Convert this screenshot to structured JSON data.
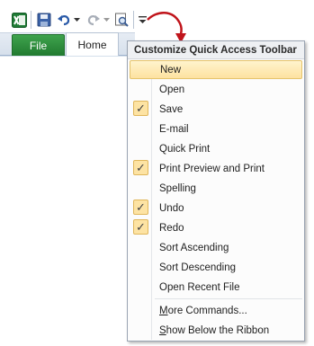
{
  "qat": {
    "icons": [
      "excel-logo-icon",
      "save-icon",
      "undo-icon",
      "dropdown-arrow-icon",
      "redo-icon",
      "dropdown-arrow-icon",
      "print-preview-icon",
      "customize-dropdown-icon"
    ]
  },
  "tabs": {
    "file": "File",
    "home": "Home"
  },
  "menu": {
    "title": "Customize Quick Access Toolbar",
    "items": [
      {
        "label": "New",
        "checked": false,
        "highlighted": true
      },
      {
        "label": "Open",
        "checked": false
      },
      {
        "label": "Save",
        "checked": true
      },
      {
        "label": "E-mail",
        "checked": false
      },
      {
        "label": "Quick Print",
        "checked": false
      },
      {
        "label": "Print Preview and Print",
        "checked": true
      },
      {
        "label": "Spelling",
        "checked": false
      },
      {
        "label": "Undo",
        "checked": true
      },
      {
        "label": "Redo",
        "checked": true
      },
      {
        "label": "Sort Ascending",
        "checked": false
      },
      {
        "label": "Sort Descending",
        "checked": false
      },
      {
        "label": "Open Recent File",
        "checked": false
      }
    ],
    "more_commands": {
      "accel": "M",
      "rest": "ore Commands..."
    },
    "show_below": {
      "accel": "S",
      "rest": "how Below the Ribbon"
    }
  },
  "colors": {
    "accent_arrow": "#c0141b",
    "file_tab": "#2f8f3d",
    "highlight": "#fde2a0"
  }
}
